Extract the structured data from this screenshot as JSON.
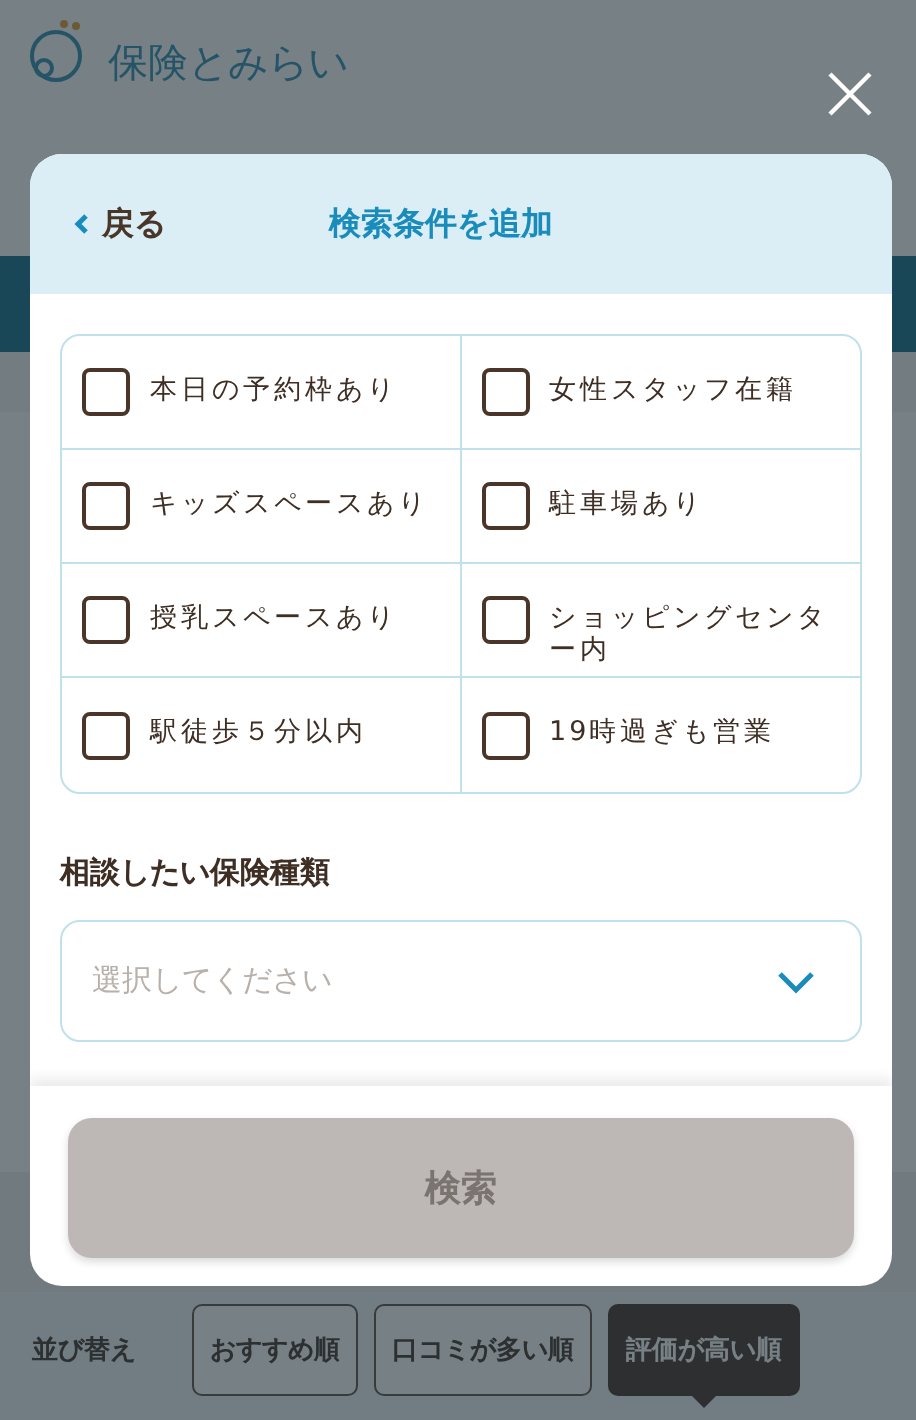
{
  "logo": {
    "text": "保険とみらい"
  },
  "modal": {
    "back": "戻る",
    "title": "検索条件を追加",
    "options": [
      {
        "label": "本日の予約枠あり",
        "checked": false
      },
      {
        "label": "女性スタッフ在籍",
        "checked": false
      },
      {
        "label": "キッズスペースあり",
        "checked": false
      },
      {
        "label": "駐車場あり",
        "checked": false
      },
      {
        "label": "授乳スペースあり",
        "checked": false
      },
      {
        "label": "ショッピングセンター内",
        "checked": false
      },
      {
        "label": "駅徒歩５分以内",
        "checked": false
      },
      {
        "label": "19時過ぎも営業",
        "checked": false
      }
    ],
    "insurance_label": "相談したい保険種類",
    "select": {
      "placeholder": "選択してください"
    },
    "search_button": {
      "label": "検索",
      "disabled": true
    }
  },
  "sort": {
    "label": "並び替え",
    "options": [
      {
        "label": "おすすめ順",
        "selected": false
      },
      {
        "label": "口コミが多い順",
        "selected": false
      },
      {
        "label": "評価が高い順",
        "selected": true
      }
    ]
  }
}
